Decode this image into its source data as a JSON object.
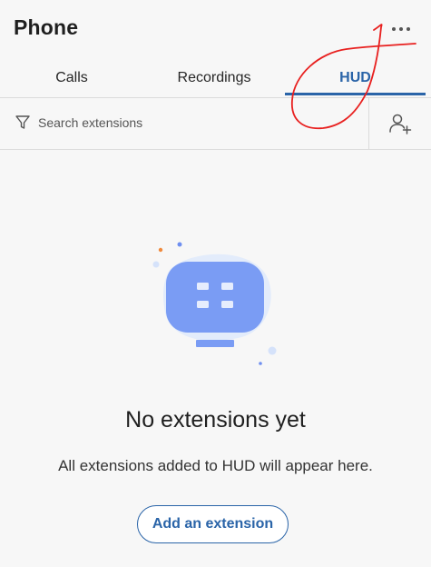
{
  "header": {
    "title": "Phone",
    "more_icon": "more-horizontal-icon"
  },
  "tabs": [
    {
      "label": "Calls",
      "active": false
    },
    {
      "label": "Recordings",
      "active": false
    },
    {
      "label": "HUD",
      "active": true
    }
  ],
  "search": {
    "placeholder": "Search extensions",
    "value": "",
    "filter_icon": "filter-icon",
    "add_icon": "add-user-icon"
  },
  "empty_state": {
    "illustration_icon": "monitor-illustration-icon",
    "title": "No extensions yet",
    "subtitle": "All extensions added to HUD will appear here.",
    "button_label": "Add an extension"
  },
  "colors": {
    "accent": "#2a64a8",
    "illustration_blue": "#7a9cf4",
    "annotation_red": "#e8201f"
  }
}
